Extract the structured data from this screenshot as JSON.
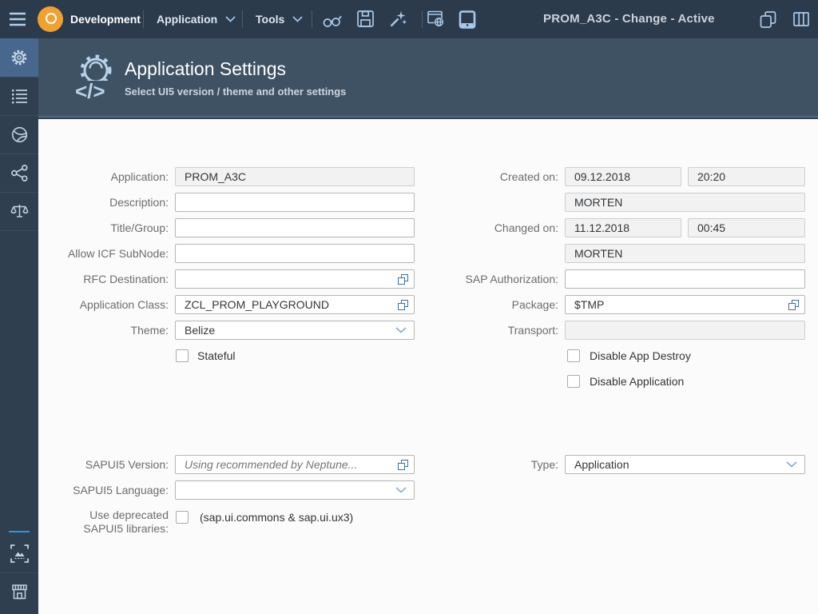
{
  "topbar": {
    "brand": "Development",
    "menus": [
      {
        "label": "Application"
      },
      {
        "label": "Tools"
      }
    ],
    "window_title": "PROM_A3C - Change - Active",
    "icons": [
      "hamburger-icon",
      "logo-circle",
      "glasses-icon",
      "save-icon",
      "magic-wand-icon",
      "preview-browser-icon",
      "mobile-preview-icon",
      "copy-icon",
      "layout-columns-icon"
    ]
  },
  "sidebar": {
    "items": [
      "settings",
      "list",
      "globe",
      "share",
      "scales",
      "screenshot",
      "store"
    ],
    "active": "settings"
  },
  "header": {
    "title": "Application Settings",
    "subtitle": "Select UI5 version / theme and other settings"
  },
  "colors": {
    "topbar": "#2b3b4c",
    "sidebar": "#2f3f50",
    "sidebar_active": "#47678c",
    "header": "#3f5264",
    "logo": "#efa230",
    "accent_icon": "#a9c9e8",
    "value_help": "#3e6f9e",
    "readonly_bg": "#f2f2f2"
  },
  "form": {
    "left": {
      "application": {
        "label": "Application:",
        "value": "PROM_A3C"
      },
      "description": {
        "label": "Description:",
        "value": ""
      },
      "title_group": {
        "label": "Title/Group:",
        "value": ""
      },
      "allow_icf_subnode": {
        "label": "Allow ICF SubNode:",
        "value": ""
      },
      "rfc_destination": {
        "label": "RFC Destination:",
        "value": ""
      },
      "application_class": {
        "label": "Application Class:",
        "value": "ZCL_PROM_PLAYGROUND"
      },
      "theme": {
        "label": "Theme:",
        "value": "Belize"
      },
      "stateful": {
        "label": "Stateful",
        "checked": false
      }
    },
    "right": {
      "created_on": {
        "label": "Created on:",
        "date": "09.12.2018",
        "time": "20:20",
        "user": "MORTEN"
      },
      "changed_on": {
        "label": "Changed on:",
        "date": "11.12.2018",
        "time": "00:45",
        "user": "MORTEN"
      },
      "sap_authorization": {
        "label": "SAP Authorization:",
        "value": ""
      },
      "package": {
        "label": "Package:",
        "value": "$TMP"
      },
      "transport": {
        "label": "Transport:",
        "value": ""
      },
      "disable_app_destroy": {
        "label": "Disable App Destroy",
        "checked": false
      },
      "disable_application": {
        "label": "Disable Application",
        "checked": false
      }
    },
    "bottom": {
      "sapui5_version": {
        "label": "SAPUI5 Version:",
        "value": "",
        "placeholder": "Using recommended by Neptune..."
      },
      "sapui5_language": {
        "label": "SAPUI5 Language:",
        "value": ""
      },
      "use_deprecated": {
        "label": "Use deprecated SAPUI5 libraries:",
        "note": "(sap.ui.commons & sap.ui.ux3)",
        "checked": false
      },
      "type": {
        "label": "Type:",
        "value": "Application"
      }
    }
  }
}
